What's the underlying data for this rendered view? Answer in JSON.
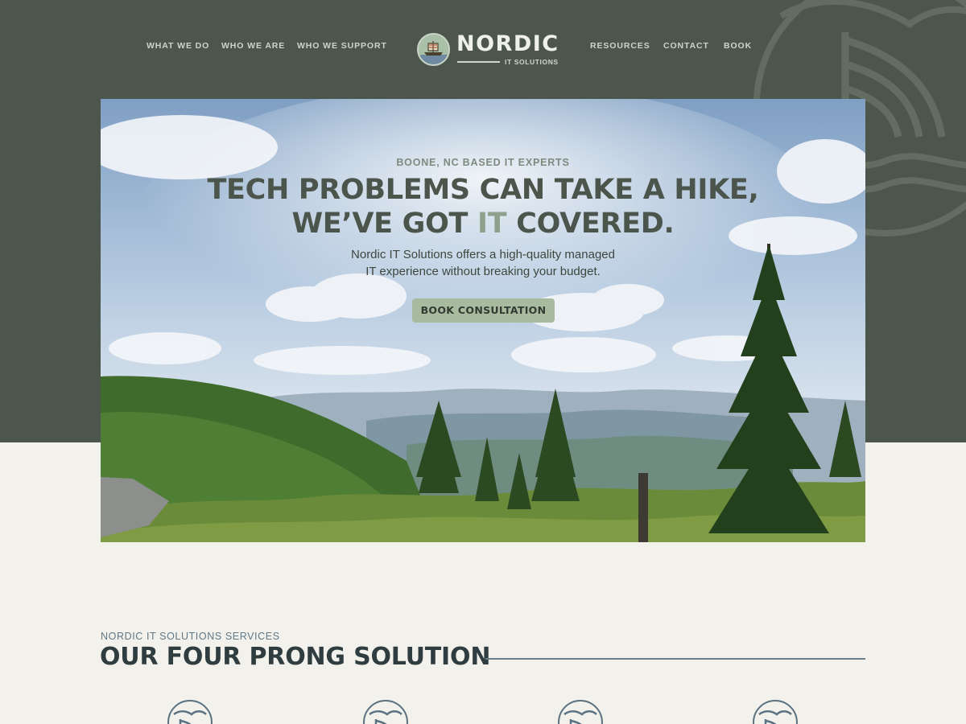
{
  "nav": {
    "left": [
      "WHAT WE DO",
      "WHO WE ARE",
      "WHO WE SUPPORT"
    ],
    "right": [
      "RESOURCES",
      "CONTACT",
      "BOOK"
    ]
  },
  "logo": {
    "word": "NORDIC",
    "sub": "IT SOLUTIONS"
  },
  "hero": {
    "eyebrow": "BOONE, NC BASED IT EXPERTS",
    "title_line1": "TECH PROBLEMS CAN TAKE A HIKE,",
    "title_line2_a": "WE’VE GOT ",
    "title_line2_accent": "IT",
    "title_line2_b": " COVERED.",
    "desc_line1": "Nordic IT Solutions offers a high-quality managed",
    "desc_line2": "IT experience without breaking your budget.",
    "cta": "BOOK CONSULTATION"
  },
  "services": {
    "eyebrow": "NORDIC IT SOLUTIONS SERVICES",
    "title": "OUR FOUR PRONG SOLUTION",
    "icons": [
      "viking-ship-icon",
      "viking-ship-icon",
      "viking-ship-icon",
      "viking-ship-icon"
    ]
  },
  "colors": {
    "header_bg": "#4d564c",
    "page_bg": "#f2f1ec",
    "cta_bg": "#a8bb9f",
    "title_text": "#4c554b",
    "accent_text": "#8fa08c",
    "services_title": "#2f3c40",
    "services_accent": "#5f7787"
  }
}
